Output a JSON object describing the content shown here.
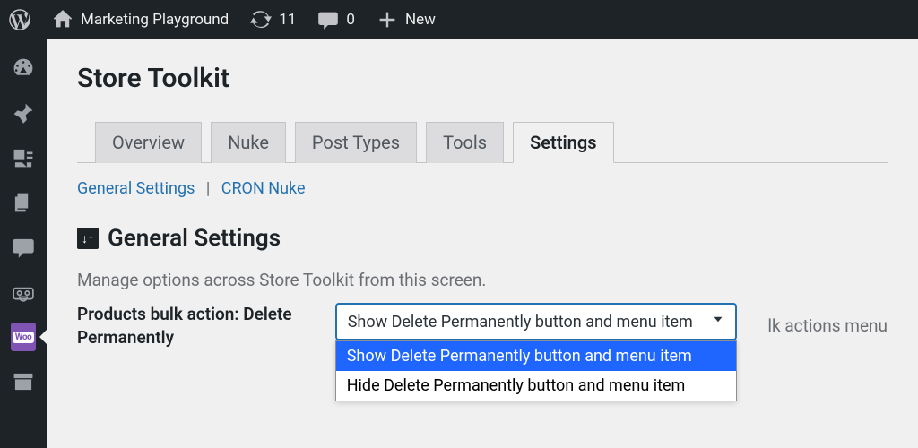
{
  "adminbar": {
    "site_name": "Marketing Playground",
    "updates": "11",
    "comments": "0",
    "new_label": "New"
  },
  "page": {
    "title": "Store Toolkit",
    "tabs": [
      "Overview",
      "Nuke",
      "Post Types",
      "Tools",
      "Settings"
    ],
    "active_tab": 4,
    "sublinks": [
      "General Settings",
      "CRON Nuke"
    ],
    "section_title": "General Settings",
    "description": "Manage options across Store Toolkit from this screen.",
    "field_label": "Products bulk action: Delete Permanently",
    "select_value": "Show Delete Permanently button and menu item",
    "options": [
      "Show Delete Permanently button and menu item",
      "Hide Delete Permanently button and menu item"
    ],
    "selected_option": 0,
    "trailing_text": "lk actions menu"
  }
}
